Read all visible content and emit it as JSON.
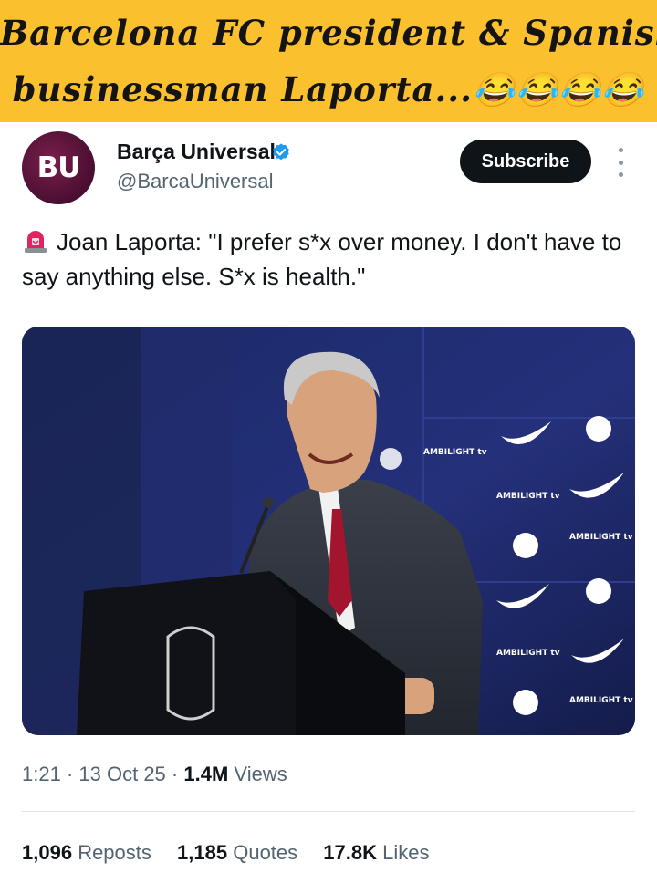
{
  "banner": {
    "line1": "Barcelona FC president & Spanish",
    "line2": "businessman Laporta...😂😂😂😂"
  },
  "author": {
    "avatar_text": "BU",
    "name": "Barça Universal",
    "handle": "@BarcaUniversal",
    "verified_icon": "verified-badge-icon",
    "accent_color": "#1d9bf0"
  },
  "actions": {
    "subscribe_label": "Subscribe",
    "more_icon": "more-options-icon"
  },
  "tweet": {
    "emoji_icon": "siren-icon",
    "text": "Joan Laporta: \"I prefer s*x over money. I don't have to say anything else. S*x is health.\""
  },
  "photo": {
    "backdrop_texts": [
      "AMBILIGHT tv",
      "AMBILIGHT tv",
      "AMBILIGHT tv",
      "AMBILIGHT tv",
      "AMBILIGHT tv",
      "AMBILIGHT tv"
    ]
  },
  "meta": {
    "time": "1:21",
    "date": "13 Oct 25",
    "views_count": "1.4M",
    "views_label": "Views"
  },
  "stats": {
    "reposts_count": "1,096",
    "reposts_label": "Reposts",
    "quotes_count": "1,185",
    "quotes_label": "Quotes",
    "likes_count": "17.8K",
    "likes_label": "Likes"
  }
}
